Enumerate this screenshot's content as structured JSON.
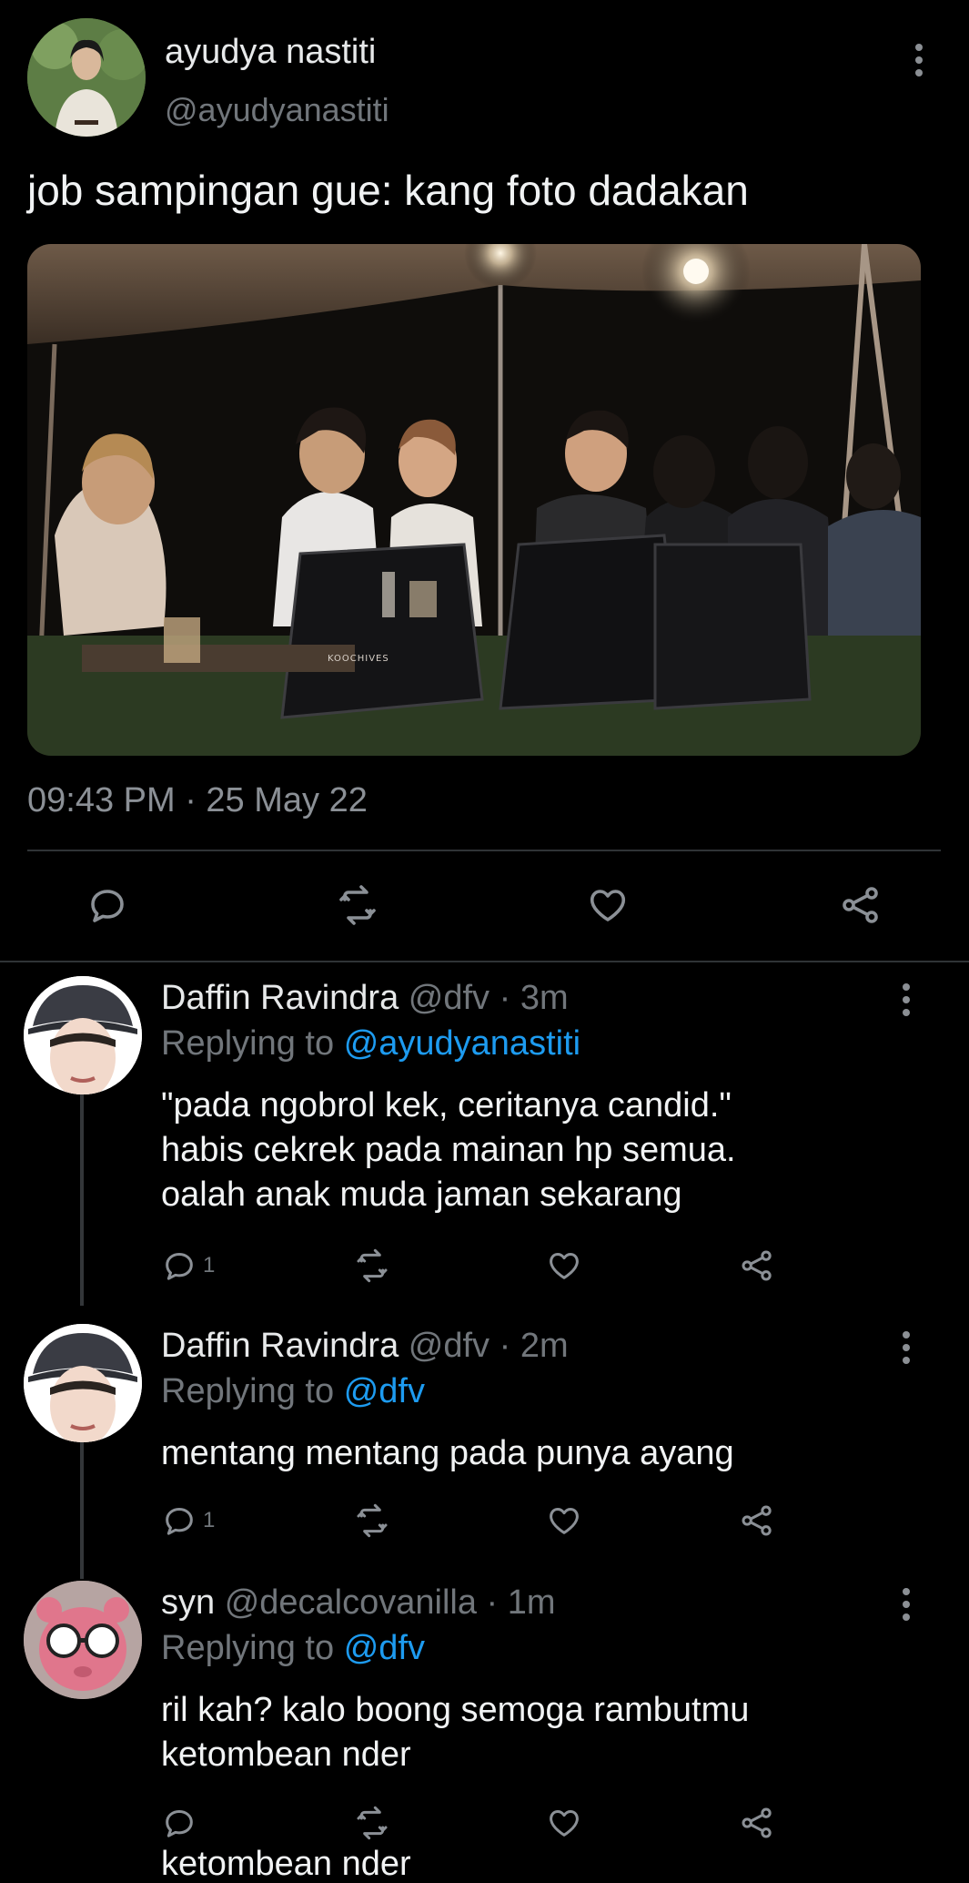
{
  "tweet": {
    "display_name": "ayudya nastiti",
    "handle": "@ayudyanastiti",
    "text": "job sampingan gue: kang foto dadakan",
    "photo_watermark": "KOOCHIVES",
    "timestamp": "09:43 PM · 25 May 22",
    "actions": [
      "reply-icon",
      "retweet-icon",
      "like-icon",
      "share-icon"
    ]
  },
  "replies": [
    {
      "display_name": "Daffin Ravindra",
      "handle": "@dfv",
      "time": "· 3m",
      "replying_prefix": "Replying to",
      "replying_to": "@ayudyanastiti",
      "text_lines": [
        "\"pada ngobrol kek, ceritanya candid.\"",
        "habis cekrek pada mainan hp semua.",
        "oalah anak muda jaman sekarang"
      ],
      "reply_count": "1"
    },
    {
      "display_name": "Daffin Ravindra",
      "handle": "@dfv",
      "time": "· 2m",
      "replying_prefix": "Replying to",
      "replying_to": "@dfv",
      "text_lines": [
        "mentang mentang pada punya ayang"
      ],
      "reply_count": "1"
    },
    {
      "display_name": "syn",
      "handle": "@decalcovanilla",
      "time": "· 1m",
      "replying_prefix": "Replying to",
      "replying_to": "@dfv",
      "text_lines": [
        "ril kah? kalo boong semoga rambutmu",
        "ketombean nder"
      ],
      "reply_count": "",
      "overflow_text": "ketombean nder"
    }
  ],
  "colors": {
    "background": "#000000",
    "text": "#e7e9ea",
    "muted": "#71767b",
    "link": "#1d9bf0",
    "divider": "#2f3336"
  }
}
